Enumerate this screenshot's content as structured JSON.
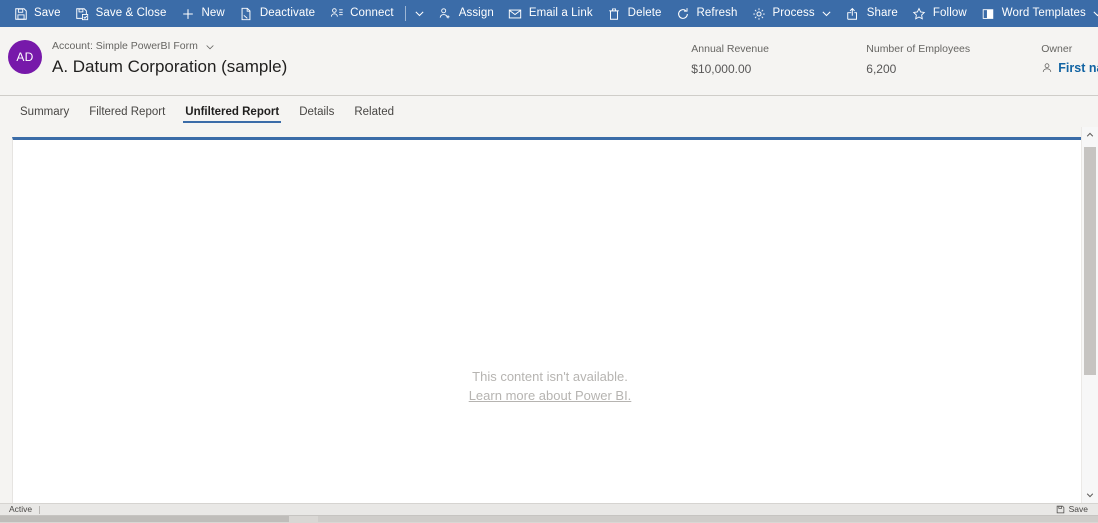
{
  "commandbar": {
    "items": [
      {
        "label": "Save",
        "icon": "save-icon",
        "chevron": false
      },
      {
        "label": "Save & Close",
        "icon": "save-close-icon",
        "chevron": false
      },
      {
        "label": "New",
        "icon": "plus-icon",
        "chevron": false
      },
      {
        "label": "Deactivate",
        "icon": "deactivate-icon",
        "chevron": false
      },
      {
        "label": "Connect",
        "icon": "connect-icon",
        "chevron": false
      },
      {
        "label": "Assign",
        "icon": "assign-icon",
        "chevron": false
      },
      {
        "label": "Email a Link",
        "icon": "email-link-icon",
        "chevron": false
      },
      {
        "label": "Delete",
        "icon": "delete-icon",
        "chevron": false
      },
      {
        "label": "Refresh",
        "icon": "refresh-icon",
        "chevron": false
      },
      {
        "label": "Process",
        "icon": "process-icon",
        "chevron": true
      },
      {
        "label": "Share",
        "icon": "share-icon",
        "chevron": false
      },
      {
        "label": "Follow",
        "icon": "star-icon",
        "chevron": false
      },
      {
        "label": "Word Templates",
        "icon": "word-templates-icon",
        "chevron": true
      }
    ],
    "background_color": "#3b6ca8"
  },
  "record_header": {
    "avatar_initials": "AD",
    "avatar_color": "#7719aa",
    "form_label": "Account: Simple PowerBI Form",
    "record_name": "A. Datum Corporation (sample)",
    "fields": [
      {
        "label": "Annual Revenue",
        "value": "$10,000.00",
        "required": false
      },
      {
        "label": "Number of Employees",
        "value": "6,200",
        "required": false
      }
    ],
    "owner": {
      "label": "Owner",
      "value": "First name Last name",
      "required": true,
      "required_marker": "*",
      "required_color": "#d13438",
      "link_color": "#1264a3"
    }
  },
  "tabs": [
    {
      "label": "Summary",
      "active": false
    },
    {
      "label": "Filtered Report",
      "active": false
    },
    {
      "label": "Unfiltered Report",
      "active": true
    },
    {
      "label": "Details",
      "active": false
    },
    {
      "label": "Related",
      "active": false
    }
  ],
  "report_panel": {
    "accent_color": "#3b6ca8",
    "empty_message": "This content isn't available.",
    "empty_link": "Learn more about Power BI."
  },
  "statusbar": {
    "state": "Active",
    "save_label": "Save"
  }
}
